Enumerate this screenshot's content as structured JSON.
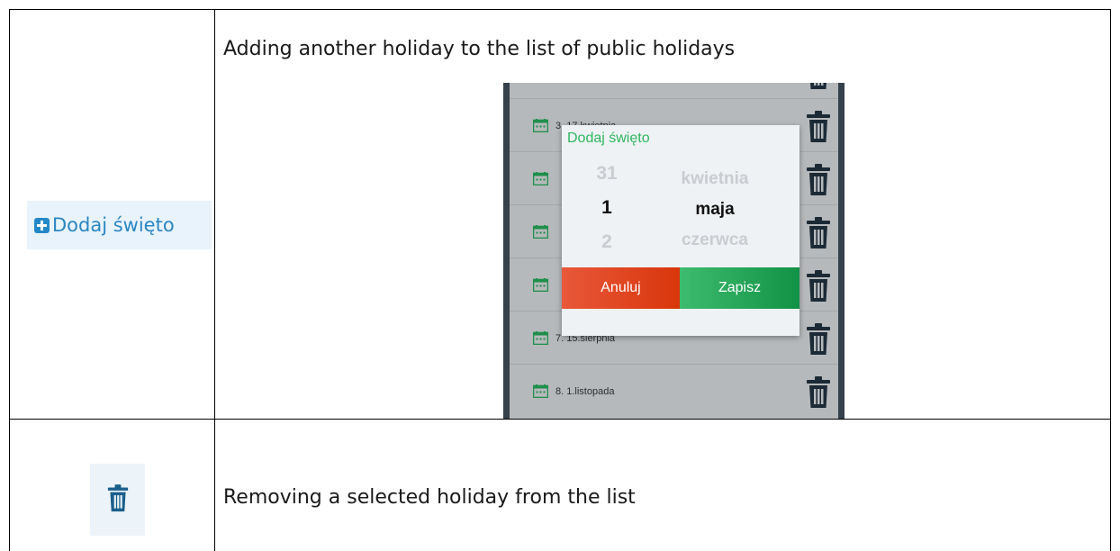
{
  "table": {
    "rows": [
      {
        "description": "Adding another holiday to the list of public holidays",
        "button_sample": {
          "label": "Dodaj święto",
          "icon": "plus-square-icon",
          "color": "#2b86c2",
          "icon_color": "#2489c9"
        }
      },
      {
        "description": "Removing a selected holiday from the list",
        "button_sample": {
          "icon": "trash-icon",
          "color": "#1b5f8c"
        }
      }
    ]
  },
  "phone_screenshot": {
    "list": [
      {
        "text": ""
      },
      {
        "text": "3. 17.kwietnia"
      },
      {
        "text": ""
      },
      {
        "text": ""
      },
      {
        "text": ""
      },
      {
        "text": "7. 15.sierpnia"
      },
      {
        "text": "8. 1.listopada"
      }
    ],
    "dialog": {
      "title": "Dodaj święto",
      "day_picker": {
        "previous": "31",
        "selected": "1",
        "next": "2"
      },
      "month_picker": {
        "previous": "kwietnia",
        "selected": "maja",
        "next": "czerwca"
      },
      "cancel_label": "Anuluj",
      "save_label": "Zapisz",
      "title_color": "#2fb65f",
      "cancel_color": "#e04a22",
      "save_color": "#27a85a"
    },
    "icon_color_calendar": "#1f8f4c",
    "icon_color_trash": "#1c2a36"
  }
}
